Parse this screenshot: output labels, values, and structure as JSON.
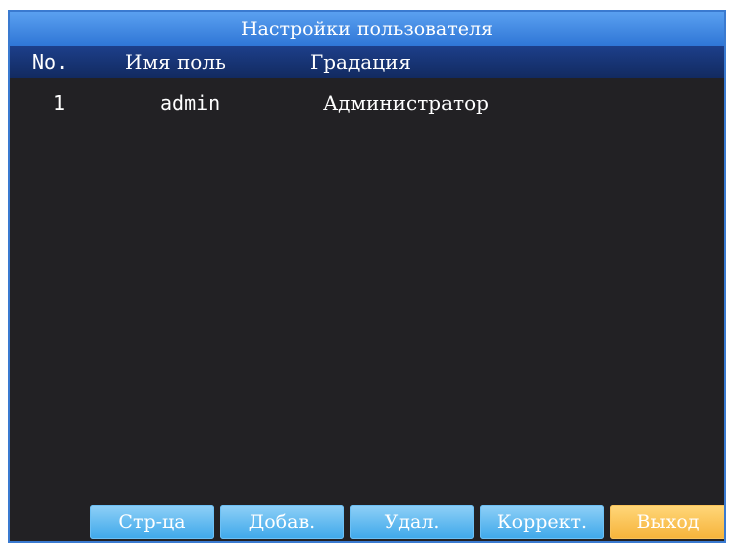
{
  "title": "Настройки пользователя",
  "columns": {
    "no": "No.",
    "name": "Имя поль",
    "grade": "Градация"
  },
  "rows": [
    {
      "no": "1",
      "name": "admin",
      "grade": "Администратор"
    }
  ],
  "buttons": {
    "page": "Стр-ца",
    "add": "Добав.",
    "delete": "Удал.",
    "edit": "Коррект.",
    "exit": "Выход"
  },
  "colors": {
    "background": "#222124",
    "title_bar": "#3f8ae4",
    "header_bar": "#1a3878",
    "button": "#5ab8f0",
    "exit_button": "#f8c04f"
  }
}
